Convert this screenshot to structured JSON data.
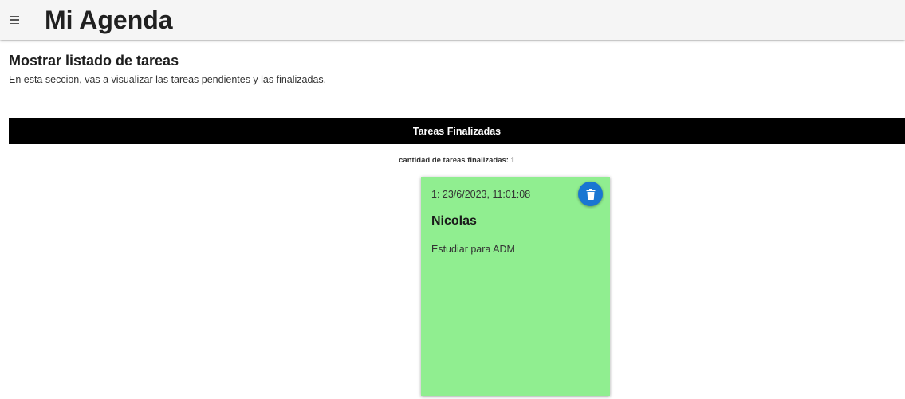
{
  "header": {
    "title": "Mi Agenda",
    "menu_icon": "menu-icon"
  },
  "section": {
    "title": "Mostrar listado de tareas",
    "description": "En esta seccion, vas a visualizar las tareas pendientes y las finalizadas."
  },
  "finished": {
    "header_label": "Tareas Finalizadas",
    "count_label": "cantidad de tareas finalizadas: 1",
    "tasks": [
      {
        "date": "1: 23/6/2023, 11:01:08",
        "name": "Nicolas",
        "description": "Estudiar para ADM",
        "delete_icon": "trash-icon"
      }
    ]
  },
  "colors": {
    "card_background": "#90ee90",
    "delete_button": "#1976d2",
    "header_bar": "#000000",
    "topbar": "#f5f5f5"
  }
}
